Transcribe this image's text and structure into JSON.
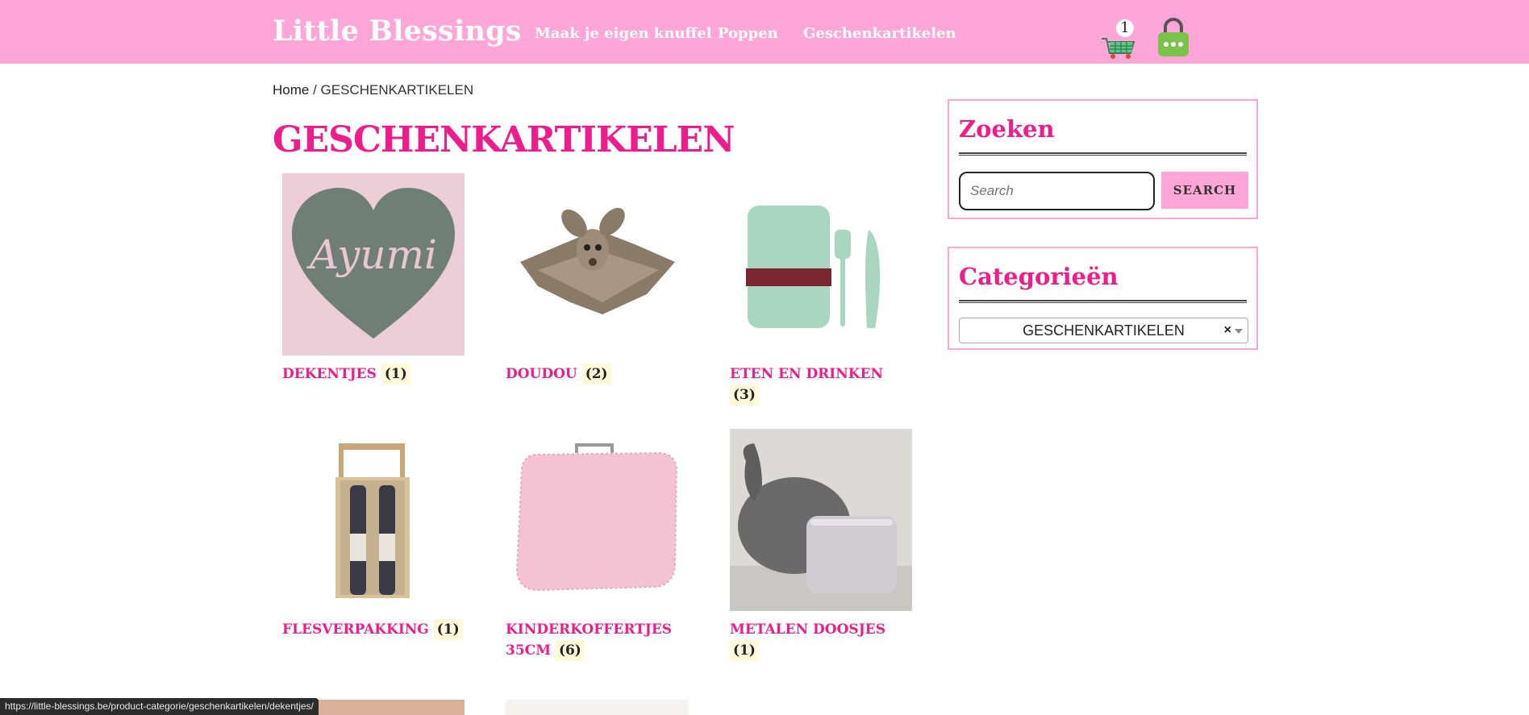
{
  "header": {
    "logo": "Little Blessings",
    "nav": [
      "Maak je eigen knuffel",
      "Poppen",
      "Geschenkartikelen"
    ],
    "cart_count": "1"
  },
  "breadcrumb": {
    "home": "Home",
    "separator": " / ",
    "current": "GESCHENKARTIKELEN"
  },
  "page_title": "GESCHENKARTIKELEN",
  "products": [
    {
      "name": "DEKENTJES",
      "count": "(1)"
    },
    {
      "name": "DOUDOU",
      "count": "(2)"
    },
    {
      "name": "ETEN EN DRINKEN",
      "count": "(3)"
    },
    {
      "name": "FLESVERPAKKING",
      "count": "(1)"
    },
    {
      "name": "KINDERKOFFERTJES 35CM",
      "count": "(6)"
    },
    {
      "name": "METALEN DOOSJES",
      "count": "(1)"
    }
  ],
  "thumb_text": {
    "dekentjes": "Ayumi"
  },
  "sidebar": {
    "search": {
      "title": "Zoeken",
      "placeholder": "Search",
      "button": "SEARCH"
    },
    "categories": {
      "title": "Categorieën",
      "selected": "GESCHENKARTIKELEN",
      "clear": "×"
    }
  },
  "status_url": "https://little-blessings.be/product-categorie/geschenkartikelen/dekentjes/",
  "colors": {
    "header_bg": "#ffa6d8",
    "accent": "#ee1c8c",
    "count_bg": "#fff8d9"
  }
}
